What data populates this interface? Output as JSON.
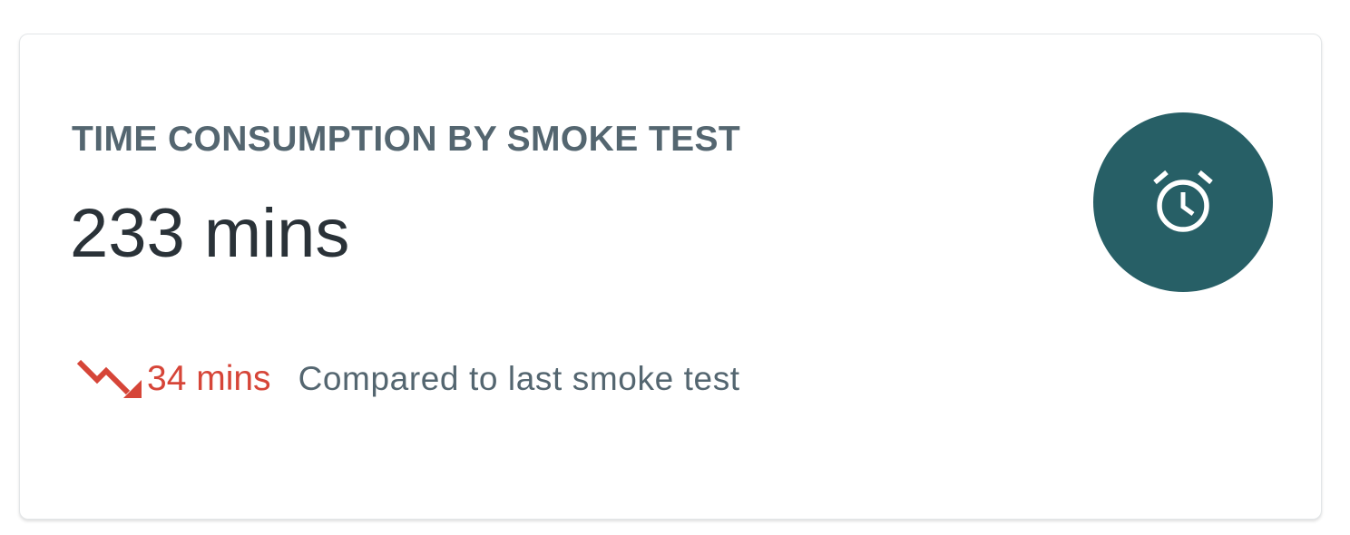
{
  "card": {
    "title": "TIME CONSUMPTION BY SMOKE TEST",
    "value": "233 mins",
    "delta": {
      "direction": "down",
      "value": "34 mins",
      "caption": "Compared to last smoke test",
      "trend_icon": "trending-down-icon",
      "color": "#d64538"
    },
    "badge": {
      "icon": "alarm-clock-icon",
      "background": "#275f66"
    }
  }
}
